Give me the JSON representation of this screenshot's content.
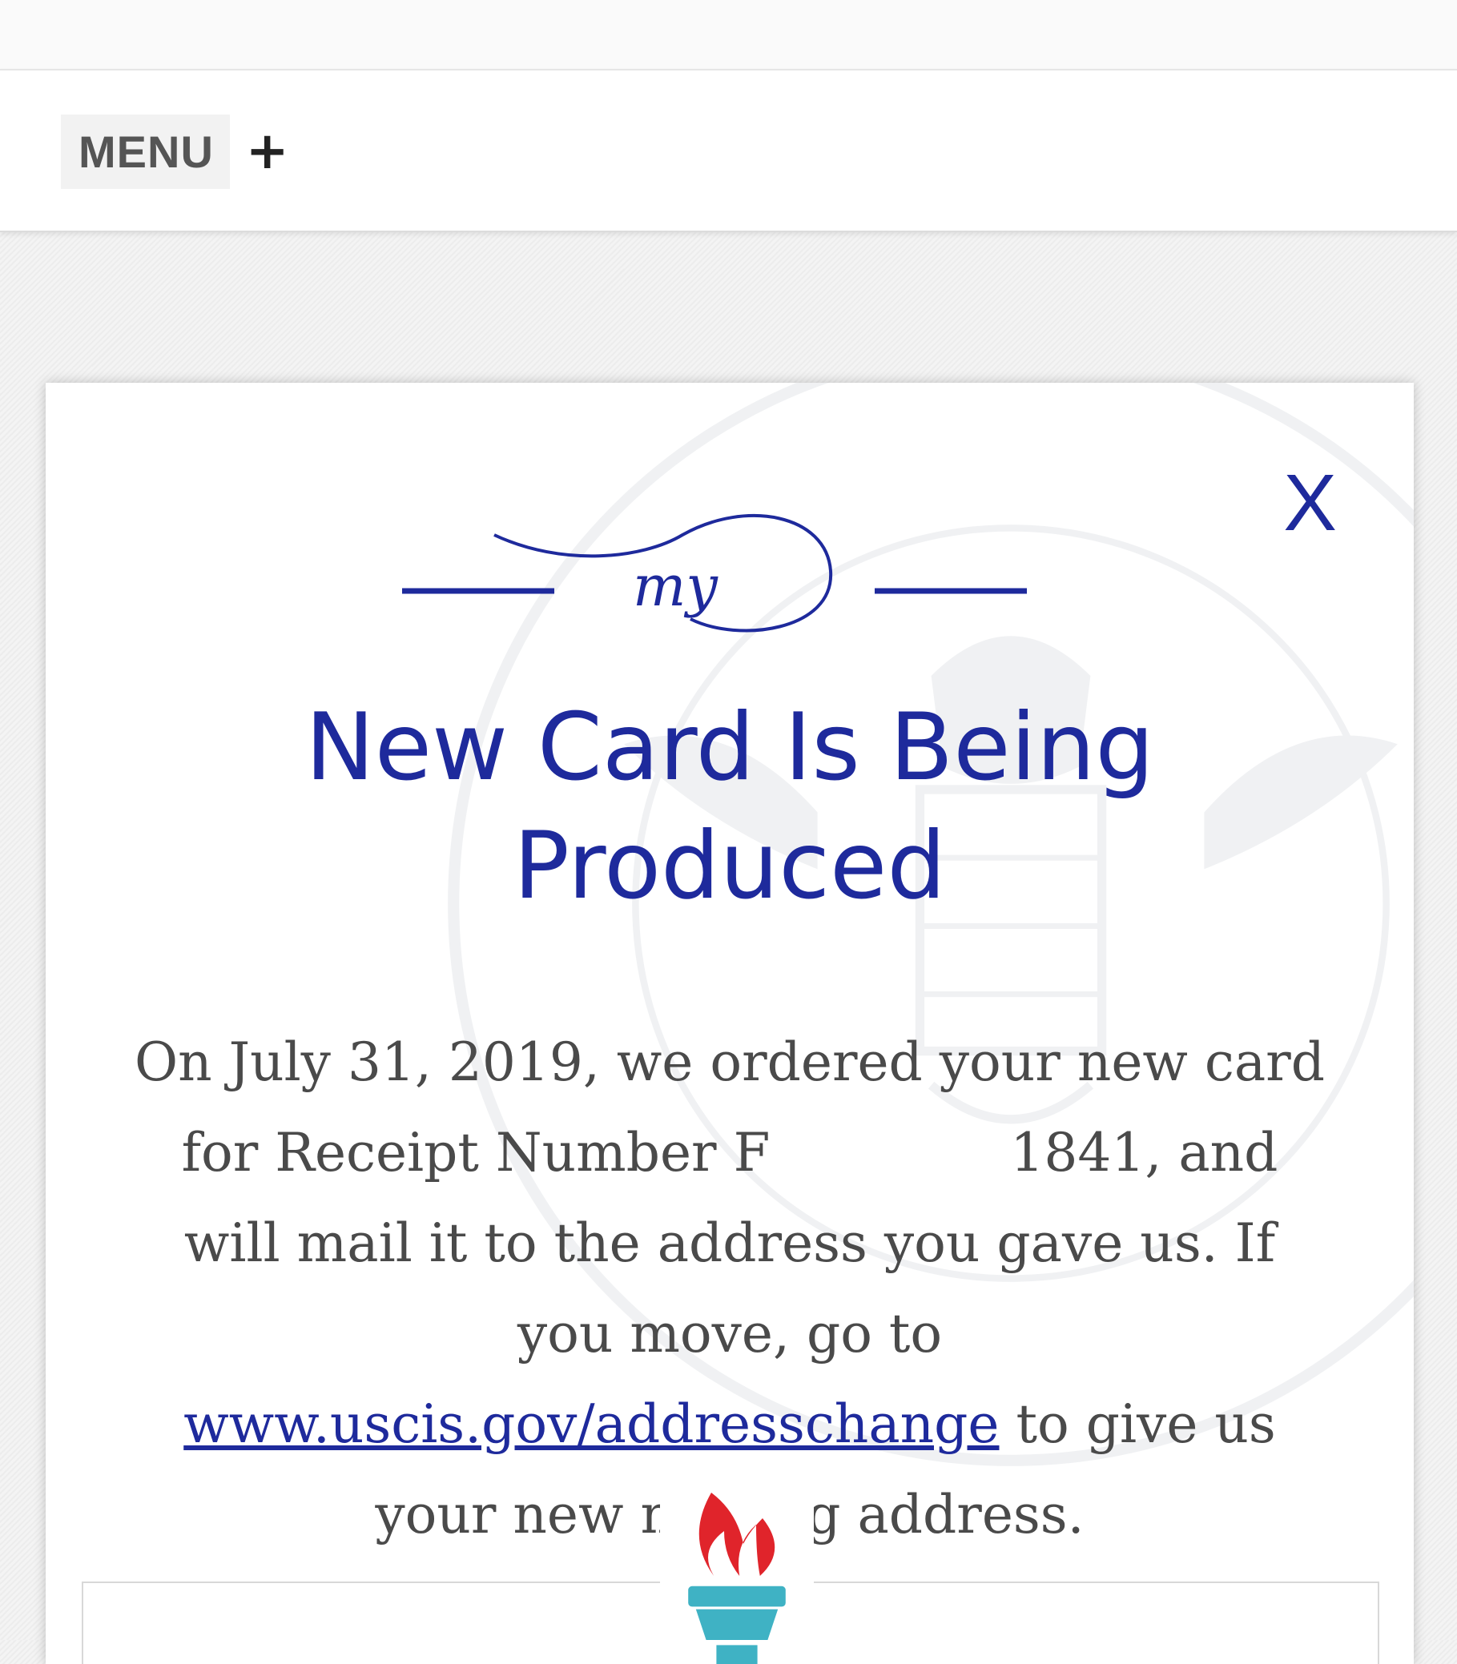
{
  "header": {
    "menu_label": "MENU",
    "menu_icon": "plus-icon"
  },
  "modal": {
    "close_label": "X",
    "logo_text": "my",
    "title_line1": "New Card Is Being",
    "title_line2": "Produced",
    "body_part1": "On July 31, 2019, we ordered your new card for Receipt Number F",
    "body_part2": "1841, and will mail it to the address you gave us. If you move, go to ",
    "link_text": "www.uscis.gov/addresschange",
    "body_part3": " to give us your new mailing address.",
    "seal_icon": "seal-watermark-icon",
    "torch_icon": "torch-icon"
  },
  "colors": {
    "brand_blue": "#1e2a9c",
    "body_text": "#4a4a4a",
    "torch_flame": "#e0242b",
    "torch_base": "#3fb2c4"
  }
}
